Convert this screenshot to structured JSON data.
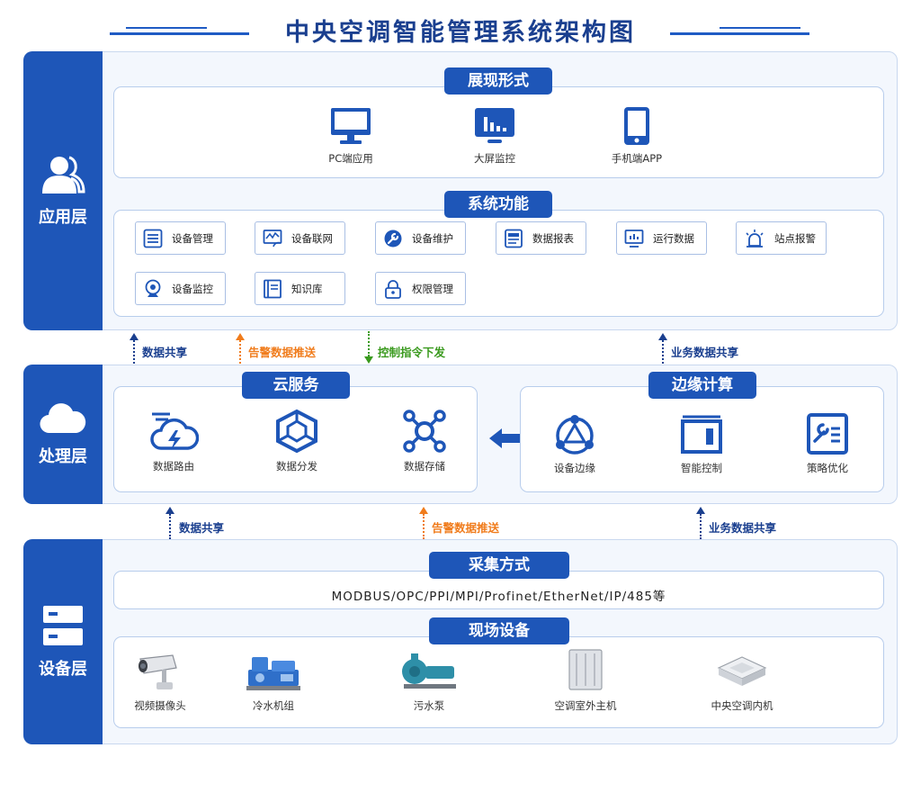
{
  "title": "中央空调智能管理系统架构图",
  "colors": {
    "primary": "#1e56b8",
    "blue_arrow": "#1a3f8f",
    "orange_arrow": "#f07c1c",
    "green_arrow": "#3a9a1e"
  },
  "app_layer": {
    "label": "应用层",
    "display": {
      "tag": "展现形式",
      "items": [
        {
          "label": "PC端应用",
          "icon": "monitor-icon"
        },
        {
          "label": "大屏监控",
          "icon": "big-screen-icon"
        },
        {
          "label": "手机端APP",
          "icon": "phone-icon"
        }
      ]
    },
    "functions": {
      "tag": "系统功能",
      "items": [
        {
          "label": "设备管理",
          "icon": "list-icon"
        },
        {
          "label": "设备联网",
          "icon": "network-icon"
        },
        {
          "label": "设备维护",
          "icon": "wrench-icon"
        },
        {
          "label": "数据报表",
          "icon": "report-icon"
        },
        {
          "label": "运行数据",
          "icon": "chart-monitor-icon"
        },
        {
          "label": "站点报警",
          "icon": "alarm-icon"
        },
        {
          "label": "设备监控",
          "icon": "camera-icon"
        },
        {
          "label": "知识库",
          "icon": "book-icon"
        },
        {
          "label": "权限管理",
          "icon": "lock-icon"
        }
      ]
    }
  },
  "arrows_top": [
    {
      "label": "数据共享",
      "color": "blue"
    },
    {
      "label": "告警数据推送",
      "color": "orange"
    },
    {
      "label": "控制指令下发",
      "color": "green"
    },
    {
      "label": "业务数据共享",
      "color": "blue"
    }
  ],
  "process_layer": {
    "label": "处理层",
    "cloud": {
      "tag": "云服务",
      "items": [
        {
          "label": "数据路由",
          "icon": "cloud-bolt-icon"
        },
        {
          "label": "数据分发",
          "icon": "hexagon-network-icon"
        },
        {
          "label": "数据存储",
          "icon": "nodes-icon"
        }
      ]
    },
    "edge": {
      "tag": "边缘计算",
      "items": [
        {
          "label": "设备边缘",
          "icon": "triangle-nodes-icon"
        },
        {
          "label": "智能控制",
          "icon": "control-box-icon"
        },
        {
          "label": "策略优化",
          "icon": "strategy-icon"
        }
      ]
    }
  },
  "arrows_bottom": [
    {
      "label": "数据共享",
      "color": "blue"
    },
    {
      "label": "告警数据推送",
      "color": "orange"
    },
    {
      "label": "业务数据共享",
      "color": "blue"
    }
  ],
  "device_layer": {
    "label": "设备层",
    "collect": {
      "tag": "采集方式",
      "protocols": "MODBUS/OPC/PPI/MPI/Profinet/EtherNet/IP/485等"
    },
    "field": {
      "tag": "现场设备",
      "items": [
        {
          "label": "视频摄像头",
          "icon": "cctv-icon"
        },
        {
          "label": "冷水机组",
          "icon": "chiller-icon"
        },
        {
          "label": "污水泵",
          "icon": "pump-icon"
        },
        {
          "label": "空调室外主机",
          "icon": "outdoor-unit-icon"
        },
        {
          "label": "中央空调内机",
          "icon": "indoor-unit-icon"
        }
      ]
    }
  }
}
